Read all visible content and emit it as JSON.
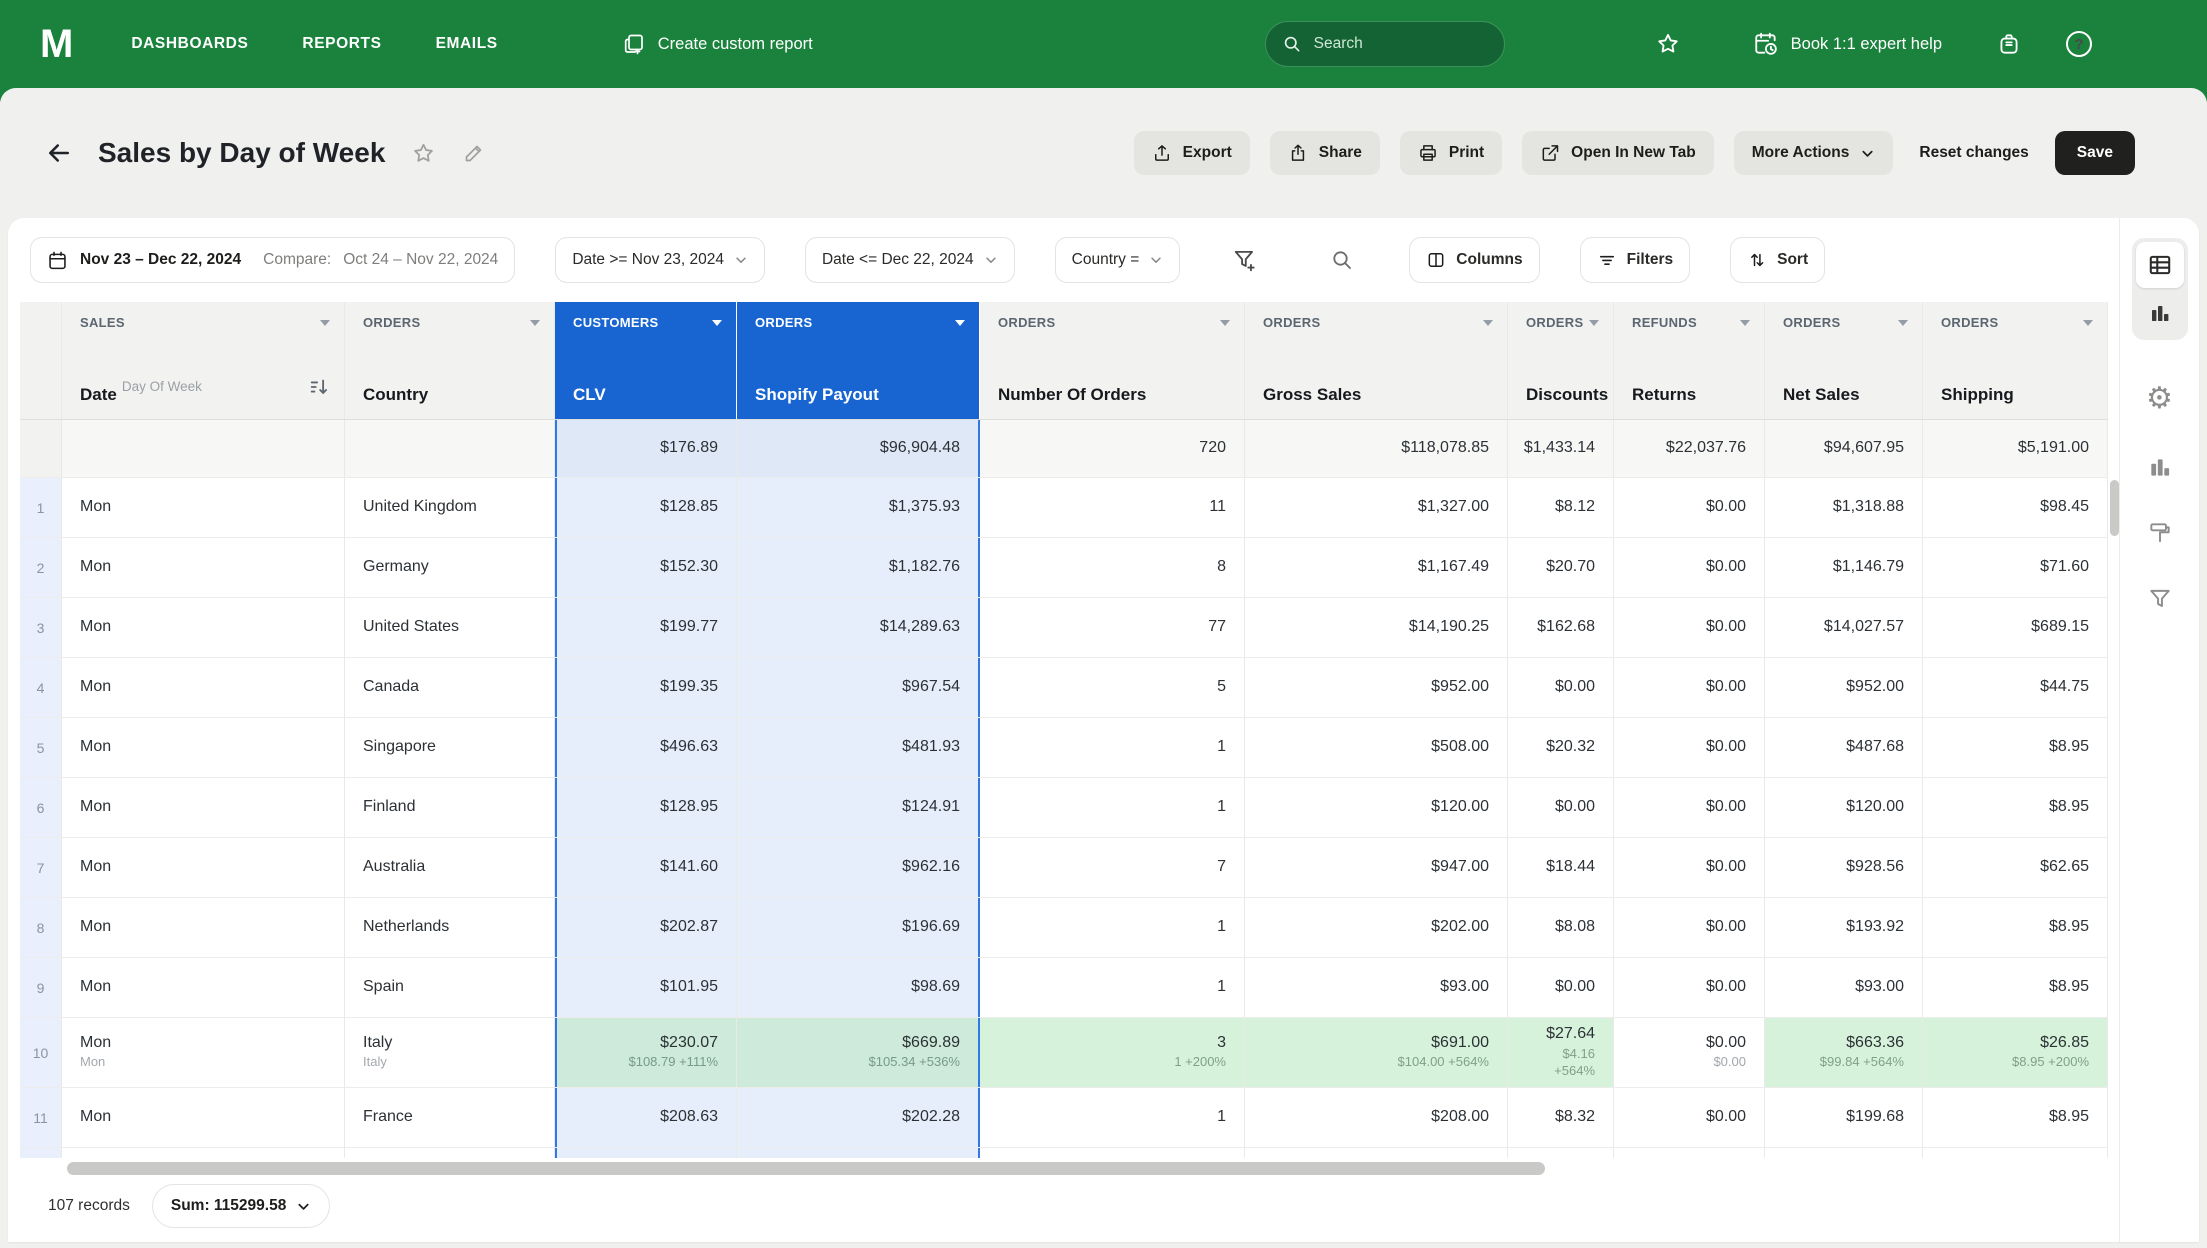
{
  "colors": {
    "brand_green": "#1a823c",
    "selection_blue": "#1865d2",
    "selection_cell_bg": "#e7eefb",
    "compare_green_bg": "#d7f2db",
    "save_button_bg": "#20201e"
  },
  "navbar": {
    "logo": "M",
    "menu": [
      "DASHBOARDS",
      "REPORTS",
      "EMAILS"
    ],
    "create_report_label": "Create custom report",
    "search_placeholder": "Search",
    "book_help_label": "Book 1:1 expert help"
  },
  "header": {
    "title": "Sales by Day of Week",
    "export_label": "Export",
    "share_label": "Share",
    "print_label": "Print",
    "open_new_tab_label": "Open In New Tab",
    "more_actions_label": "More Actions",
    "reset_label": "Reset changes",
    "save_label": "Save"
  },
  "filter_bar": {
    "date_range": "Nov 23 – Dec 22, 2024",
    "compare_label": "Compare:",
    "compare_range": "Oct 24 – Nov 22, 2024",
    "filters": [
      "Date >= Nov 23, 2024",
      "Date <= Dec 22, 2024",
      "Country ="
    ],
    "columns_label": "Columns",
    "filters_label": "Filters",
    "sort_label": "Sort"
  },
  "table": {
    "columns": [
      {
        "group": "SALES",
        "name": "Date",
        "sup": "Day Of Week",
        "sort_icon": true,
        "selected": false
      },
      {
        "group": "ORDERS",
        "name": "Country",
        "selected": false
      },
      {
        "group": "CUSTOMERS",
        "name": "CLV",
        "selected": true
      },
      {
        "group": "ORDERS",
        "name": "Shopify Payout",
        "selected": true
      },
      {
        "group": "ORDERS",
        "name": "Number Of Orders",
        "selected": false
      },
      {
        "group": "ORDERS",
        "name": "Gross Sales",
        "selected": false
      },
      {
        "group": "ORDERS",
        "name": "Discounts",
        "selected": false
      },
      {
        "group": "REFUNDS",
        "name": "Returns",
        "selected": false
      },
      {
        "group": "ORDERS",
        "name": "Net Sales",
        "selected": false
      },
      {
        "group": "ORDERS",
        "name": "Shipping",
        "selected": false
      }
    ],
    "summary_row": [
      "",
      "",
      "$176.89",
      "$96,904.48",
      "720",
      "$118,078.85",
      "$1,433.14",
      "$22,037.76",
      "$94,607.95",
      "$5,191.00"
    ],
    "rows": [
      {
        "num": "1",
        "cells": [
          "Mon",
          "United Kingdom",
          "$128.85",
          "$1,375.93",
          "11",
          "$1,327.00",
          "$8.12",
          "$0.00",
          "$1,318.88",
          "$98.45"
        ]
      },
      {
        "num": "2",
        "cells": [
          "Mon",
          "Germany",
          "$152.30",
          "$1,182.76",
          "8",
          "$1,167.49",
          "$20.70",
          "$0.00",
          "$1,146.79",
          "$71.60"
        ]
      },
      {
        "num": "3",
        "cells": [
          "Mon",
          "United States",
          "$199.77",
          "$14,289.63",
          "77",
          "$14,190.25",
          "$162.68",
          "$0.00",
          "$14,027.57",
          "$689.15"
        ]
      },
      {
        "num": "4",
        "cells": [
          "Mon",
          "Canada",
          "$199.35",
          "$967.54",
          "5",
          "$952.00",
          "$0.00",
          "$0.00",
          "$952.00",
          "$44.75"
        ]
      },
      {
        "num": "5",
        "cells": [
          "Mon",
          "Singapore",
          "$496.63",
          "$481.93",
          "1",
          "$508.00",
          "$20.32",
          "$0.00",
          "$487.68",
          "$8.95"
        ]
      },
      {
        "num": "6",
        "cells": [
          "Mon",
          "Finland",
          "$128.95",
          "$124.91",
          "1",
          "$120.00",
          "$0.00",
          "$0.00",
          "$120.00",
          "$8.95"
        ]
      },
      {
        "num": "7",
        "cells": [
          "Mon",
          "Australia",
          "$141.60",
          "$962.16",
          "7",
          "$947.00",
          "$18.44",
          "$0.00",
          "$928.56",
          "$62.65"
        ]
      },
      {
        "num": "8",
        "cells": [
          "Mon",
          "Netherlands",
          "$202.87",
          "$196.69",
          "1",
          "$202.00",
          "$8.08",
          "$0.00",
          "$193.92",
          "$8.95"
        ]
      },
      {
        "num": "9",
        "cells": [
          "Mon",
          "Spain",
          "$101.95",
          "$98.69",
          "1",
          "$93.00",
          "$0.00",
          "$0.00",
          "$93.00",
          "$8.95"
        ]
      },
      {
        "num": "10",
        "cells": [
          "Mon",
          "Italy",
          "$230.07",
          "$669.89",
          "3",
          "$691.00",
          "$27.64",
          "$0.00",
          "$663.36",
          "$26.85"
        ],
        "sub": [
          "Mon",
          "Italy",
          "$108.79 +111%",
          "$105.34 +536%",
          "1 +200%",
          "$104.00 +564%",
          "$4.16 +564%",
          "$0.00",
          "$99.84 +564%",
          "$8.95 +200%"
        ],
        "highlight_cols": [
          2,
          3,
          4,
          5,
          6,
          8,
          9
        ]
      },
      {
        "num": "11",
        "cells": [
          "Mon",
          "France",
          "$208.63",
          "$202.28",
          "1",
          "$208.00",
          "$8.32",
          "$0.00",
          "$199.68",
          "$8.95"
        ]
      }
    ]
  },
  "footer": {
    "records": "107 records",
    "sum_label": "Sum: 115299.58"
  }
}
